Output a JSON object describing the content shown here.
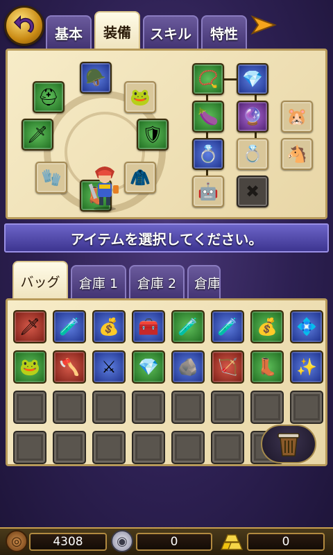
{
  "tabs": [
    {
      "label": "基本",
      "active": false
    },
    {
      "label": "装備",
      "active": true
    },
    {
      "label": "スキル",
      "active": false
    },
    {
      "label": "特性",
      "active": false
    }
  ],
  "equipment": {
    "left_slots": [
      {
        "name": "helmet",
        "icon": "🪖",
        "style": "blue"
      },
      {
        "name": "head",
        "icon": "⛑",
        "style": "green"
      },
      {
        "name": "accessory-top-right",
        "icon": "🐸",
        "style": "empty"
      },
      {
        "name": "weapon",
        "icon": "🗡",
        "style": "green"
      },
      {
        "name": "shield",
        "icon": "🛡",
        "style": "green"
      },
      {
        "name": "gloves",
        "icon": "🧤",
        "style": "empty"
      },
      {
        "name": "armor",
        "icon": "🧥",
        "style": "empty"
      },
      {
        "name": "boots",
        "icon": "👢",
        "style": "green"
      }
    ],
    "right_slots": [
      {
        "name": "necklace",
        "icon": "📿",
        "style": "green"
      },
      {
        "name": "pendant",
        "icon": "💎",
        "style": "blue"
      },
      {
        "name": "charm",
        "icon": "🍆",
        "style": "green"
      },
      {
        "name": "bracelet",
        "icon": "🔮",
        "style": "purple"
      },
      {
        "name": "pet",
        "icon": "🐹",
        "style": "empty"
      },
      {
        "name": "ring",
        "icon": "💍",
        "style": "blue"
      },
      {
        "name": "ring-2",
        "icon": "💍",
        "style": "empty"
      },
      {
        "name": "mount",
        "icon": "🐴",
        "style": "empty"
      },
      {
        "name": "robot",
        "icon": "🤖",
        "style": "empty"
      },
      {
        "name": "locked",
        "icon": "✖",
        "style": "dark"
      }
    ]
  },
  "message": "アイテムを選択してください。",
  "inventory_tabs": [
    {
      "label": "バッグ",
      "active": true
    },
    {
      "label": "倉庫 1",
      "active": false
    },
    {
      "label": "倉庫 2",
      "active": false
    },
    {
      "label": "倉庫",
      "active": false
    }
  ],
  "inventory": {
    "items": [
      {
        "name": "sword",
        "icon": "🗡",
        "style": "r"
      },
      {
        "name": "red-potion",
        "icon": "🧪",
        "style": "item"
      },
      {
        "name": "money-bag",
        "icon": "💰",
        "style": "item"
      },
      {
        "name": "treasure-chest",
        "icon": "🧰",
        "style": "item"
      },
      {
        "name": "red-potion",
        "icon": "🧪",
        "style": "g"
      },
      {
        "name": "red-potion",
        "icon": "🧪",
        "style": "item"
      },
      {
        "name": "money-bag",
        "icon": "💰",
        "style": "g"
      },
      {
        "name": "crystal",
        "icon": "💠",
        "style": "item"
      },
      {
        "name": "frog",
        "icon": "🐸",
        "style": "g"
      },
      {
        "name": "axe",
        "icon": "🪓",
        "style": "r"
      },
      {
        "name": "crossed-swords",
        "icon": "⚔",
        "style": "item"
      },
      {
        "name": "diamond",
        "icon": "💎",
        "style": "g"
      },
      {
        "name": "ore",
        "icon": "🪨",
        "style": "item"
      },
      {
        "name": "bow",
        "icon": "🏹",
        "style": "r"
      },
      {
        "name": "boots",
        "icon": "👢",
        "style": "g"
      },
      {
        "name": "gold-ore",
        "icon": "✨",
        "style": "item"
      }
    ],
    "total_slots": 31
  },
  "currency": {
    "gold": "4308",
    "silver": "0",
    "gems": "0"
  }
}
